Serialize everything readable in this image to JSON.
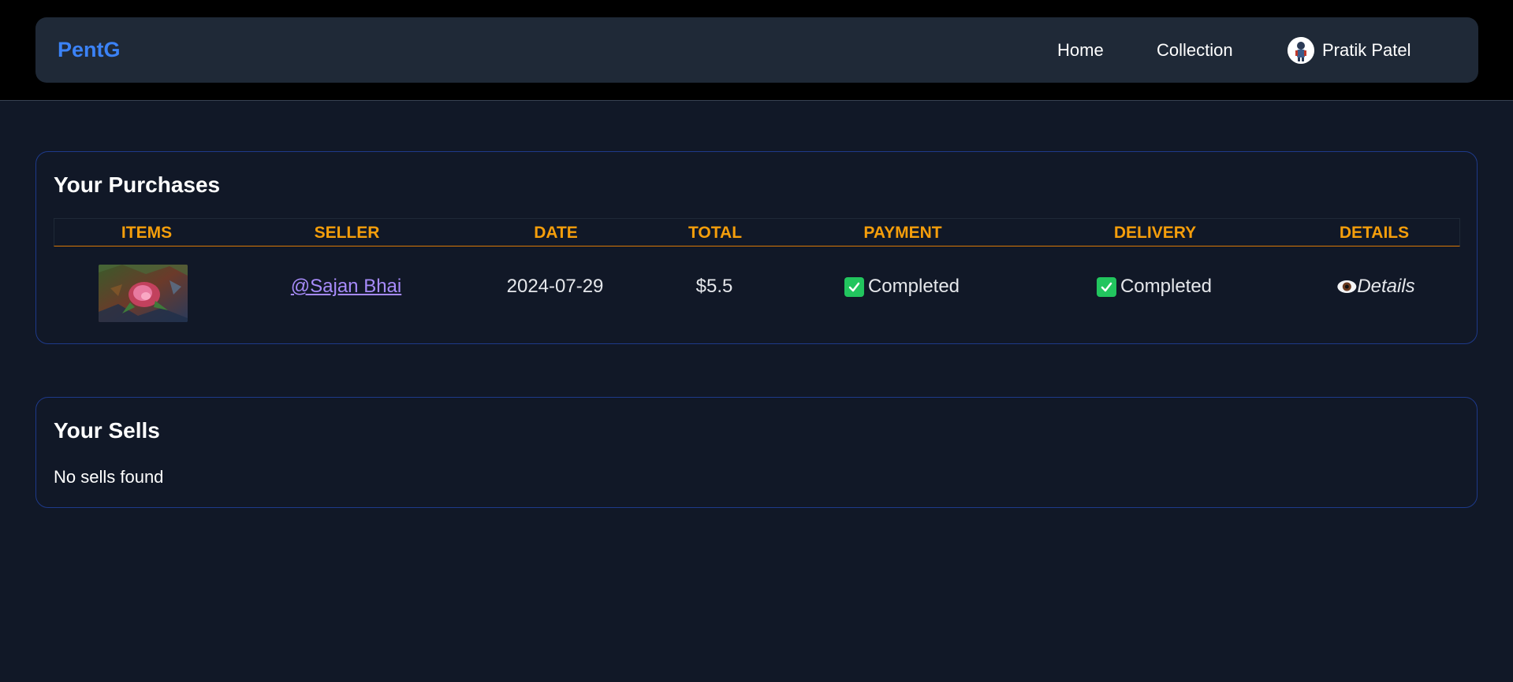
{
  "navbar": {
    "brand": "PentG",
    "links": [
      {
        "label": "Home"
      },
      {
        "label": "Collection"
      }
    ],
    "user": {
      "name": "Pratik Patel"
    }
  },
  "purchases": {
    "title": "Your Purchases",
    "columns": [
      "ITEMS",
      "SELLER",
      "DATE",
      "TOTAL",
      "PAYMENT",
      "DELIVERY",
      "DETAILS"
    ],
    "rows": [
      {
        "item_image": "rose-painting-thumbnail",
        "seller": "@Sajan Bhai",
        "date": "2024-07-29",
        "total": "$5.5",
        "payment": "Completed",
        "delivery": "Completed",
        "details": "Details"
      }
    ]
  },
  "sells": {
    "title": "Your Sells",
    "empty_message": "No sells found"
  },
  "colors": {
    "brand": "#3b82f6",
    "header_text": "#f59e0b",
    "status_check": "#22c55e",
    "seller_link": "#a78bfa"
  }
}
